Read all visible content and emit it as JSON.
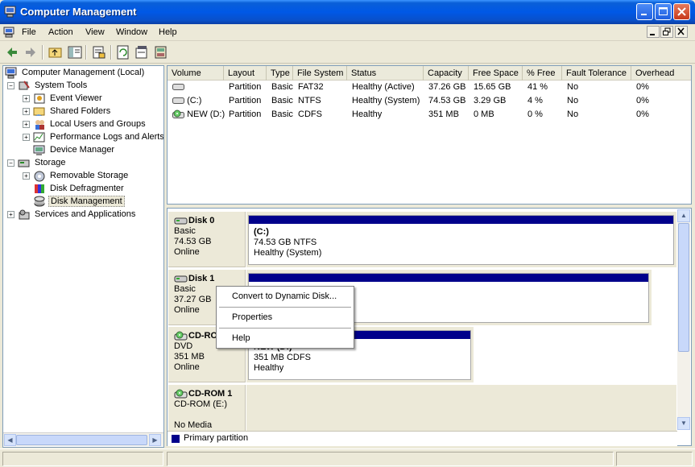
{
  "window": {
    "title": "Computer Management",
    "accent": "#0058e6",
    "partition_color": "#00008b"
  },
  "menu": {
    "items": [
      "File",
      "Action",
      "View",
      "Window",
      "Help"
    ]
  },
  "tree": {
    "items": [
      {
        "label": "Computer Management (Local)",
        "icon": "computer-icon",
        "expander": ""
      },
      {
        "label": "System Tools",
        "icon": "system-tools-icon",
        "expander": "−"
      },
      {
        "label": "Event Viewer",
        "icon": "event-viewer-icon",
        "expander": "+"
      },
      {
        "label": "Shared Folders",
        "icon": "shared-folders-icon",
        "expander": "+"
      },
      {
        "label": "Local Users and Groups",
        "icon": "users-icon",
        "expander": "+"
      },
      {
        "label": "Performance Logs and Alerts",
        "icon": "performance-icon",
        "expander": "+"
      },
      {
        "label": "Device Manager",
        "icon": "device-manager-icon",
        "expander": ""
      },
      {
        "label": "Storage",
        "icon": "storage-icon",
        "expander": "−"
      },
      {
        "label": "Removable Storage",
        "icon": "removable-storage-icon",
        "expander": "+"
      },
      {
        "label": "Disk Defragmenter",
        "icon": "defragmenter-icon",
        "expander": ""
      },
      {
        "label": "Disk Management",
        "icon": "disk-management-icon",
        "expander": "",
        "selected": true
      },
      {
        "label": "Services and Applications",
        "icon": "services-icon",
        "expander": "+"
      }
    ]
  },
  "volumes": {
    "columns": [
      "Volume",
      "Layout",
      "Type",
      "File System",
      "Status",
      "Capacity",
      "Free Space",
      "% Free",
      "Fault Tolerance",
      "Overhead"
    ],
    "rows": [
      [
        "",
        "Partition",
        "Basic",
        "FAT32",
        "Healthy (Active)",
        "37.26 GB",
        "15.65 GB",
        "41 %",
        "No",
        "0%"
      ],
      [
        "(C:)",
        "Partition",
        "Basic",
        "NTFS",
        "Healthy (System)",
        "74.53 GB",
        "3.29 GB",
        "4 %",
        "No",
        "0%"
      ],
      [
        "NEW (D:)",
        "Partition",
        "Basic",
        "CDFS",
        "Healthy",
        "351 MB",
        "0 MB",
        "0 %",
        "No",
        "0%"
      ]
    ]
  },
  "disks": [
    {
      "name": "Disk 0",
      "type": "Basic",
      "size": "74.53 GB",
      "status": "Online",
      "partition": {
        "name": "(C:)",
        "size": "74.53 GB NTFS",
        "status": "Healthy (System)"
      }
    },
    {
      "name": "Disk 1",
      "type": "Basic",
      "size": "37.27 GB",
      "status": "Online"
    },
    {
      "name": "CD-ROM 0",
      "type": "DVD",
      "size": "351 MB",
      "status": "Online",
      "partition": {
        "name": "NEW (D:)",
        "size": "351 MB CDFS",
        "status": "Healthy"
      }
    },
    {
      "name": "CD-ROM 1",
      "type": "CD-ROM (E:)",
      "size": "",
      "status": "No Media"
    }
  ],
  "legend": {
    "label": "Primary partition"
  },
  "context_menu": {
    "items": [
      "Convert to Dynamic Disk...",
      "Properties",
      "Help"
    ]
  }
}
